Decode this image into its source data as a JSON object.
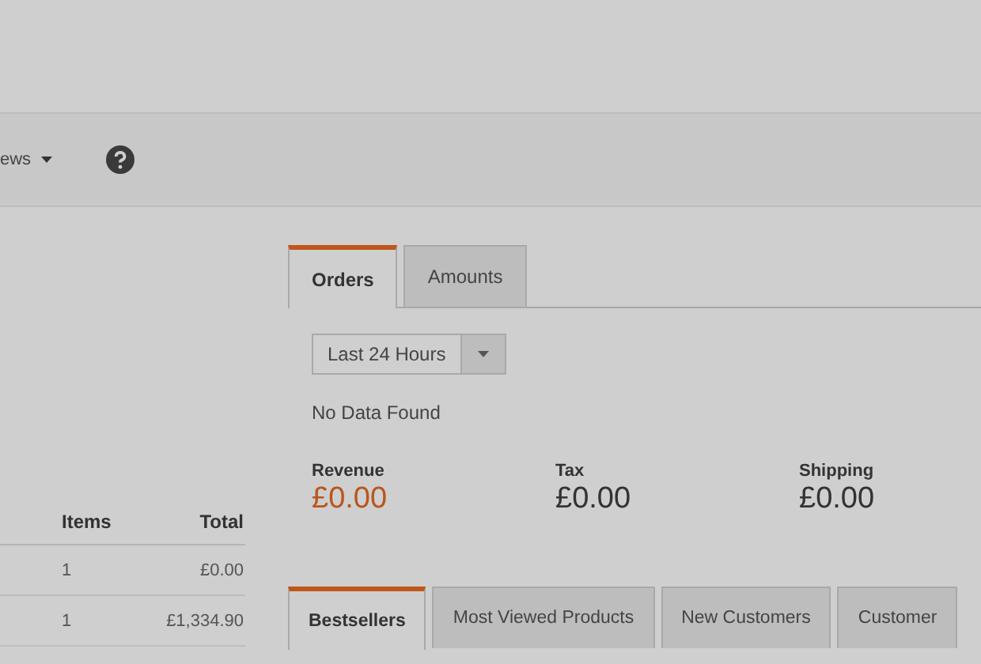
{
  "toolbar": {
    "menu_label": "ews"
  },
  "orders_table": {
    "columns": [
      "Items",
      "Total"
    ],
    "rows": [
      {
        "items": "1",
        "total": "£0.00"
      },
      {
        "items": "1",
        "total": "£1,334.90"
      }
    ]
  },
  "chart_tabs": [
    {
      "label": "Orders",
      "selected": true
    },
    {
      "label": "Amounts",
      "selected": false
    }
  ],
  "period_select": {
    "value": "Last 24 Hours"
  },
  "chart_message": "No Data Found",
  "totals": [
    {
      "label": "Revenue",
      "value": "£0.00",
      "highlight": true
    },
    {
      "label": "Tax",
      "value": "£0.00",
      "highlight": false
    },
    {
      "label": "Shipping",
      "value": "£0.00",
      "highlight": false
    }
  ],
  "grid_tabs": [
    {
      "label": "Bestsellers",
      "selected": true
    },
    {
      "label": "Most Viewed Products",
      "selected": false
    },
    {
      "label": "New Customers",
      "selected": false
    },
    {
      "label": "Customer",
      "selected": false
    }
  ]
}
